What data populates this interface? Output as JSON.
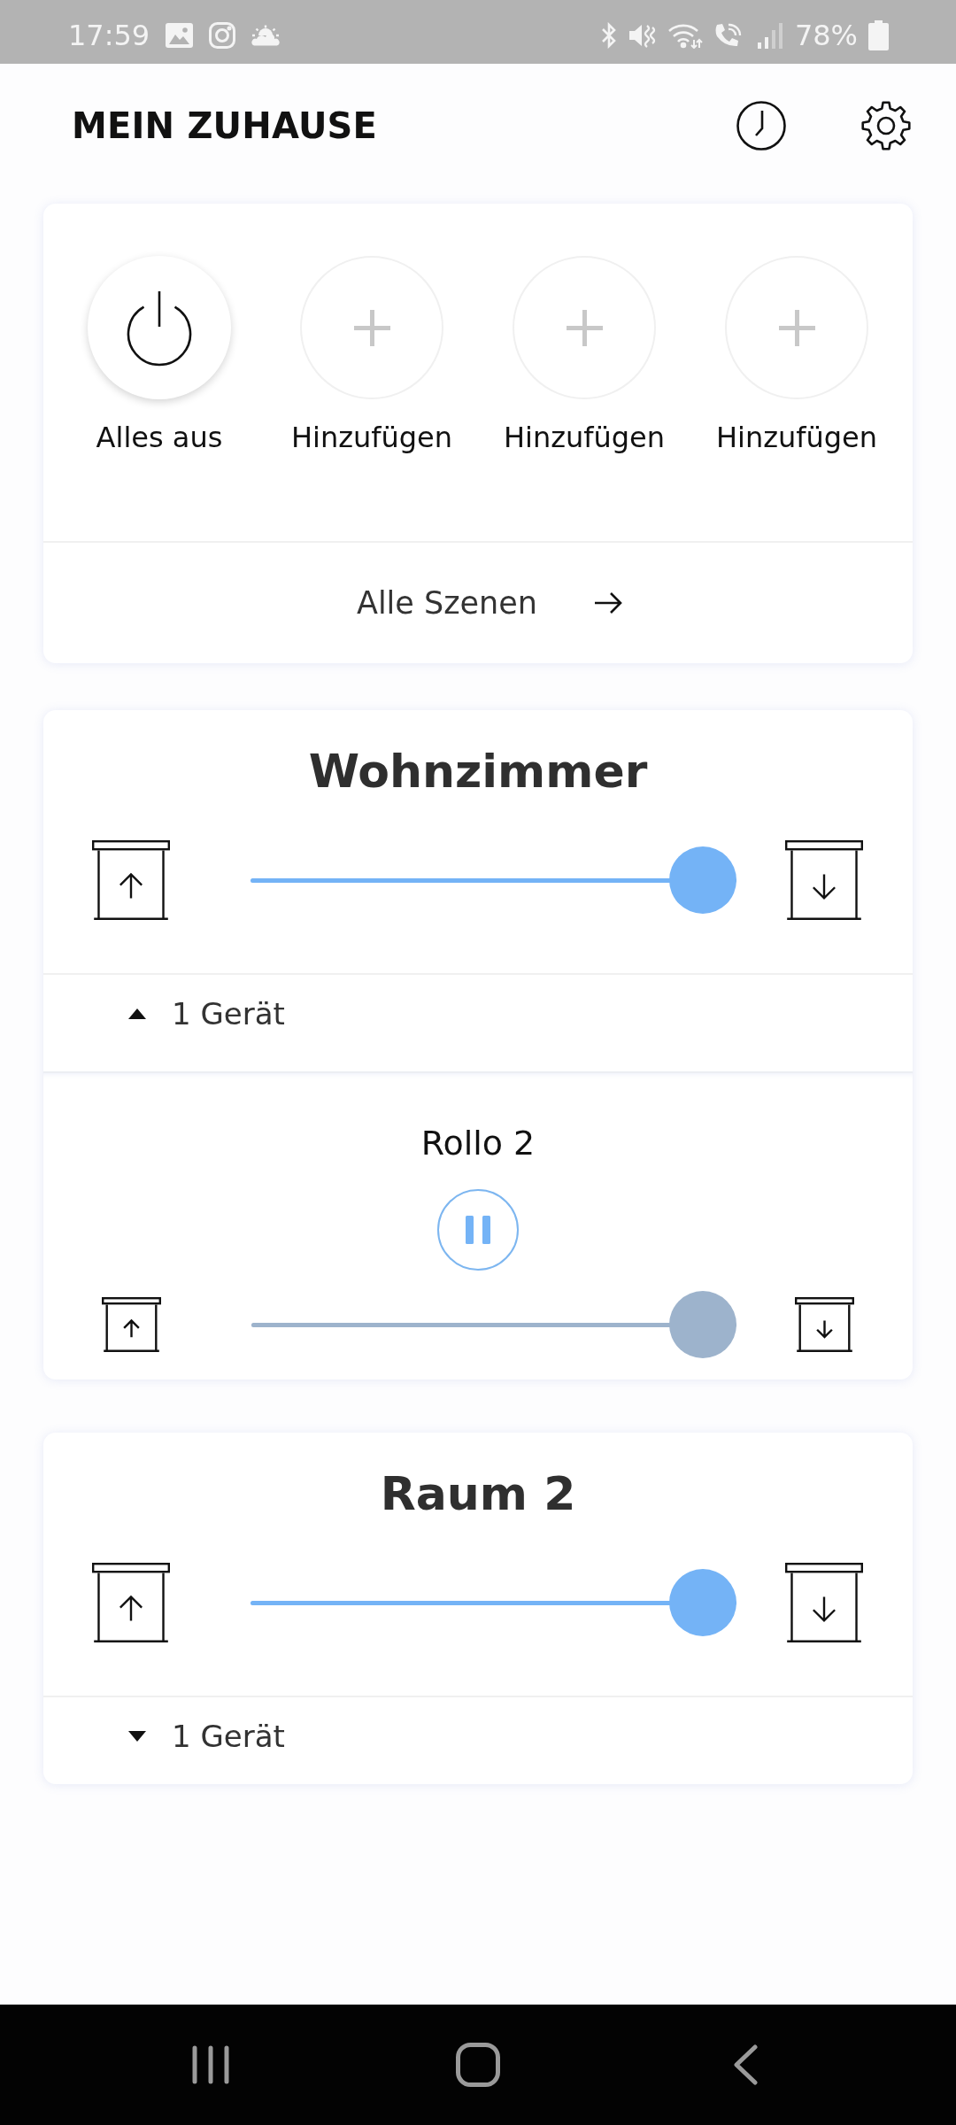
{
  "status_bar": {
    "time": "17:59",
    "battery": "78%"
  },
  "header": {
    "title": "MEIN ZUHAUSE"
  },
  "scenes": {
    "items": [
      {
        "kind": "power",
        "label": "Alles aus"
      },
      {
        "kind": "add",
        "label": "Hinzufügen"
      },
      {
        "kind": "add",
        "label": "Hinzufügen"
      },
      {
        "kind": "add",
        "label": "Hinzufügen"
      }
    ],
    "link": "Alle Szenen"
  },
  "rooms": [
    {
      "name": "Wohnzimmer",
      "level": 1,
      "device_count": "1 Gerät",
      "expanded": true,
      "devices": [
        {
          "name": "Rollo 2",
          "level": 1,
          "moving": true
        }
      ]
    },
    {
      "name": "Raum 2",
      "level": 1,
      "device_count": "1 Gerät",
      "expanded": false
    }
  ]
}
